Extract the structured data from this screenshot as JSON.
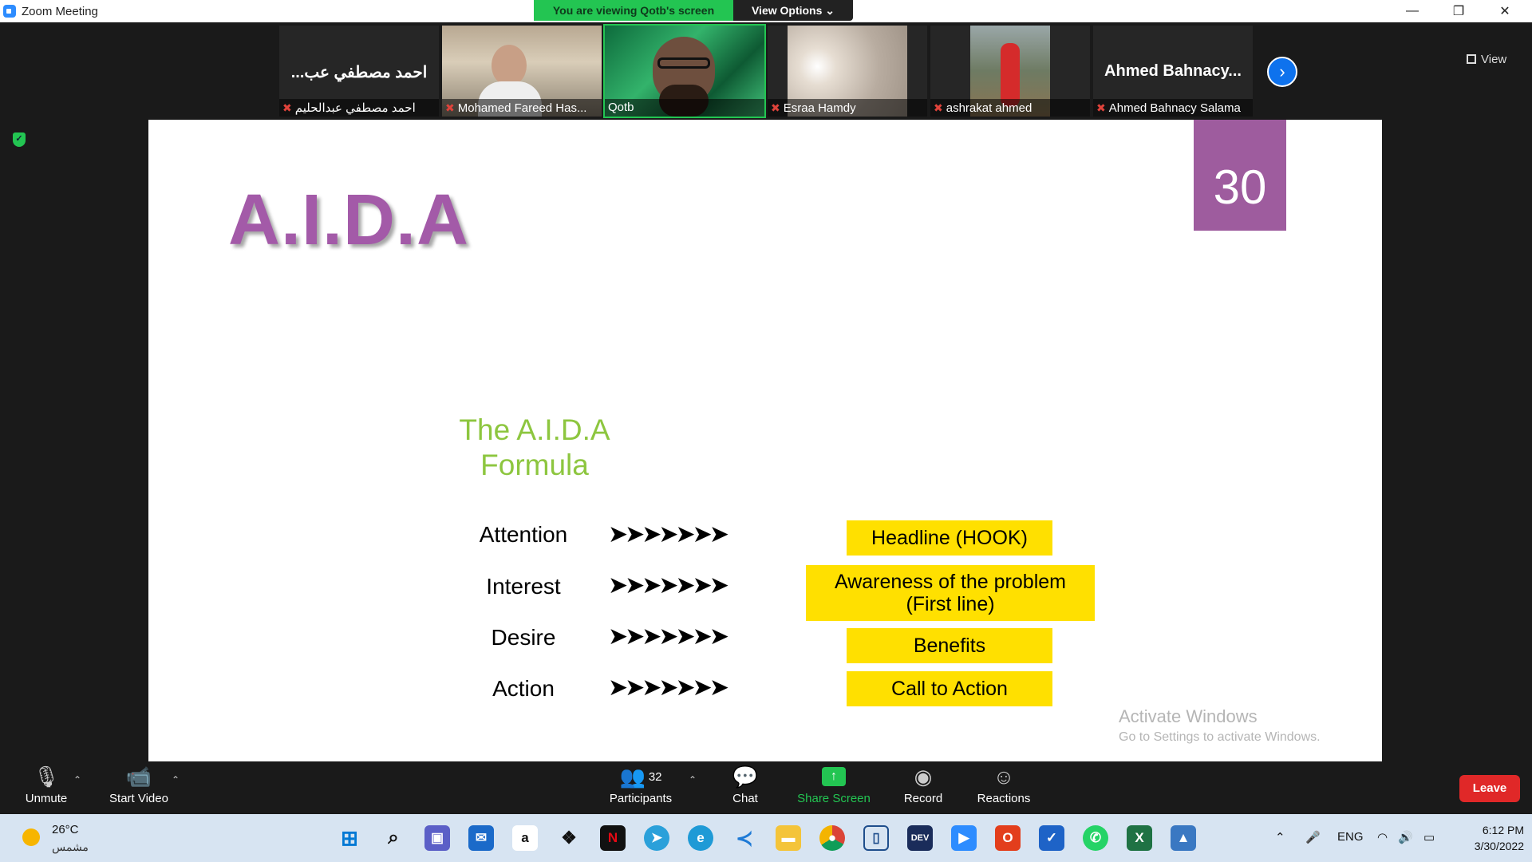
{
  "window": {
    "title": "Zoom Meeting",
    "minimize": "—",
    "restore": "❐",
    "close": "✕"
  },
  "share_banner": {
    "status": "You are viewing Qotb's screen",
    "view_options": "View Options ⌄"
  },
  "participants_strip": {
    "tiles": [
      {
        "big_name": "...احمد مصطفي عب",
        "label": "احمد مصطفي عبدالحليم",
        "muted": true
      },
      {
        "big_name": "",
        "label": "Mohamed Fareed Has...",
        "muted": true
      },
      {
        "big_name": "",
        "label": "Qotb",
        "muted": false
      },
      {
        "big_name": "",
        "label": "Esraa Hamdy",
        "muted": true
      },
      {
        "big_name": "",
        "label": "ashrakat ahmed",
        "muted": true
      },
      {
        "big_name": "Ahmed  Bahnacy...",
        "label": "Ahmed Bahnacy Salama",
        "muted": true
      }
    ],
    "next_icon": "›",
    "view_label": "View"
  },
  "slide": {
    "number": "30",
    "title": "A.I.D.A",
    "formula_title_line1": "The A.I.D.A",
    "formula_title_line2": "Formula",
    "arrows": "➤➤➤➤➤➤➤",
    "rows": [
      {
        "step": "Attention",
        "box": "Headline (HOOK)"
      },
      {
        "step": "Interest",
        "box_line1": "Awareness of the problem",
        "box_line2": "(First line)"
      },
      {
        "step": "Desire",
        "box": "Benefits"
      },
      {
        "step": "Action",
        "box": "Call to Action"
      }
    ],
    "activate_title": "Activate Windows",
    "activate_sub": "Go to Settings to activate Windows.",
    "colors": {
      "title": "#a35aa8",
      "number_bg": "#9e5c9e",
      "formula": "#8dc63f",
      "box": "#ffe000"
    }
  },
  "controls": {
    "unmute": "Unmute",
    "start_video": "Start Video",
    "participants": "Participants",
    "participants_count": "32",
    "chat": "Chat",
    "share_screen": "Share Screen",
    "record": "Record",
    "reactions": "Reactions",
    "leave": "Leave"
  },
  "taskbar": {
    "weather_temp": "26°C",
    "weather_desc": "مشمس",
    "amazon_label": "a",
    "netflix_label": "N",
    "dev_label": "DEV",
    "excel_label": "X",
    "language": "ENG",
    "time": "6:12 PM",
    "date": "3/30/2022"
  }
}
